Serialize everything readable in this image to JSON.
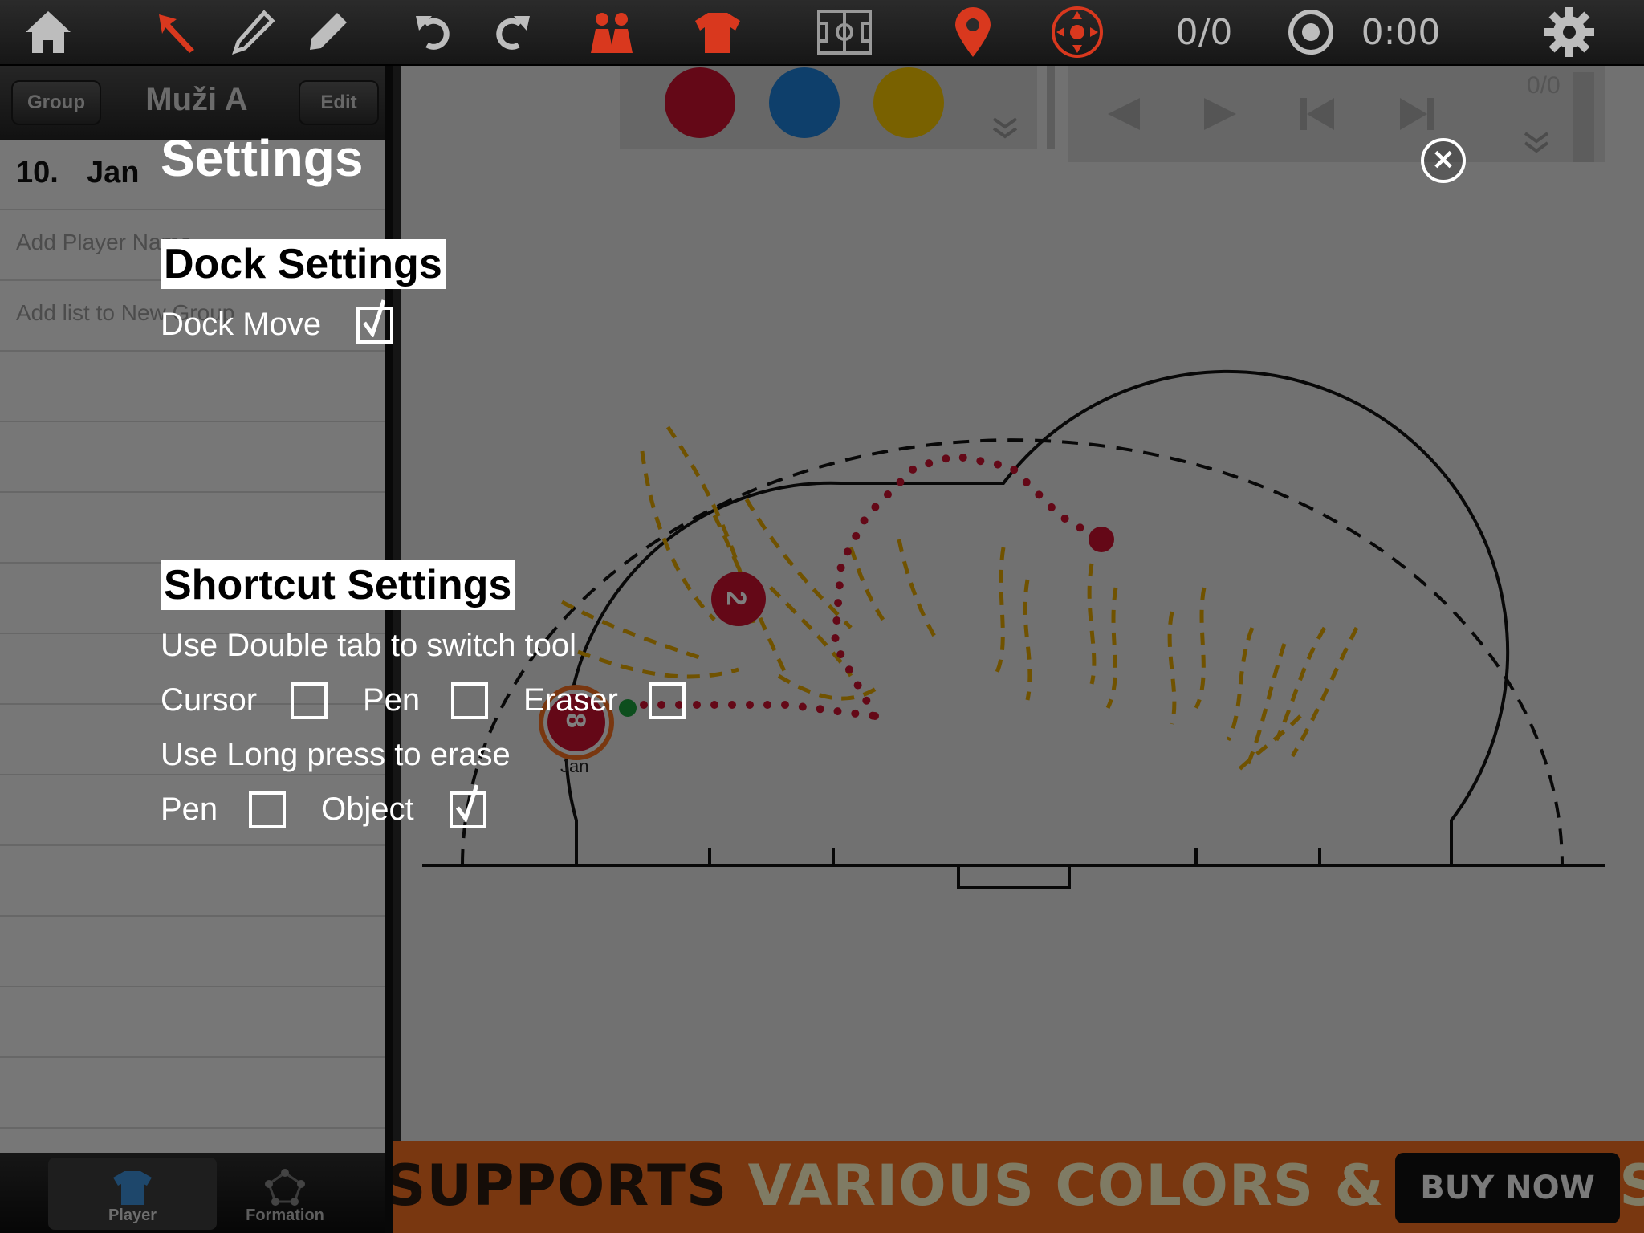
{
  "toolbar": {
    "icons": [
      "home-icon",
      "cursor-icon",
      "pen-icon",
      "eraser-icon",
      "undo-icon",
      "redo-icon",
      "team-icon",
      "jersey-icon",
      "field-icon",
      "marker-icon",
      "target-icon"
    ],
    "score": "0/0",
    "timer": "0:00"
  },
  "sidebar": {
    "group_button": "Group",
    "title": "Muži A",
    "edit_button": "Edit",
    "player_number": "10.",
    "player_name": "Jan",
    "add_player_placeholder": "Add Player Name",
    "add_list_placeholder": "Add list to New Group",
    "tabs": [
      {
        "label": "Player",
        "active": true
      },
      {
        "label": "Formation",
        "active": false
      }
    ]
  },
  "board": {
    "palette_colors": [
      "#c8102e",
      "#1c7ed6",
      "#f2c200"
    ],
    "playback_counter": "0/0",
    "player_token_number": "2",
    "player_token_label": "Jan",
    "player_token_pin": "8"
  },
  "ad": {
    "text_dark": "SUPPORTS",
    "text_light": "VARIOUS COLORS & SHAPES",
    "buy_button": "BUY NOW"
  },
  "settings": {
    "title": "Settings",
    "dock_section": "Dock Settings",
    "dock_move_label": "Dock Move",
    "dock_move_checked": true,
    "shortcut_section": "Shortcut Settings",
    "double_tap_label": "Use Double tab to switch tool",
    "cursor_label": "Cursor",
    "cursor_checked": false,
    "pen_label": "Pen",
    "pen_checked": false,
    "eraser_label": "Eraser",
    "eraser_checked": false,
    "long_press_label": "Use Long press to erase",
    "lp_pen_label": "Pen",
    "lp_pen_checked": false,
    "lp_object_label": "Object",
    "lp_object_checked": true
  }
}
